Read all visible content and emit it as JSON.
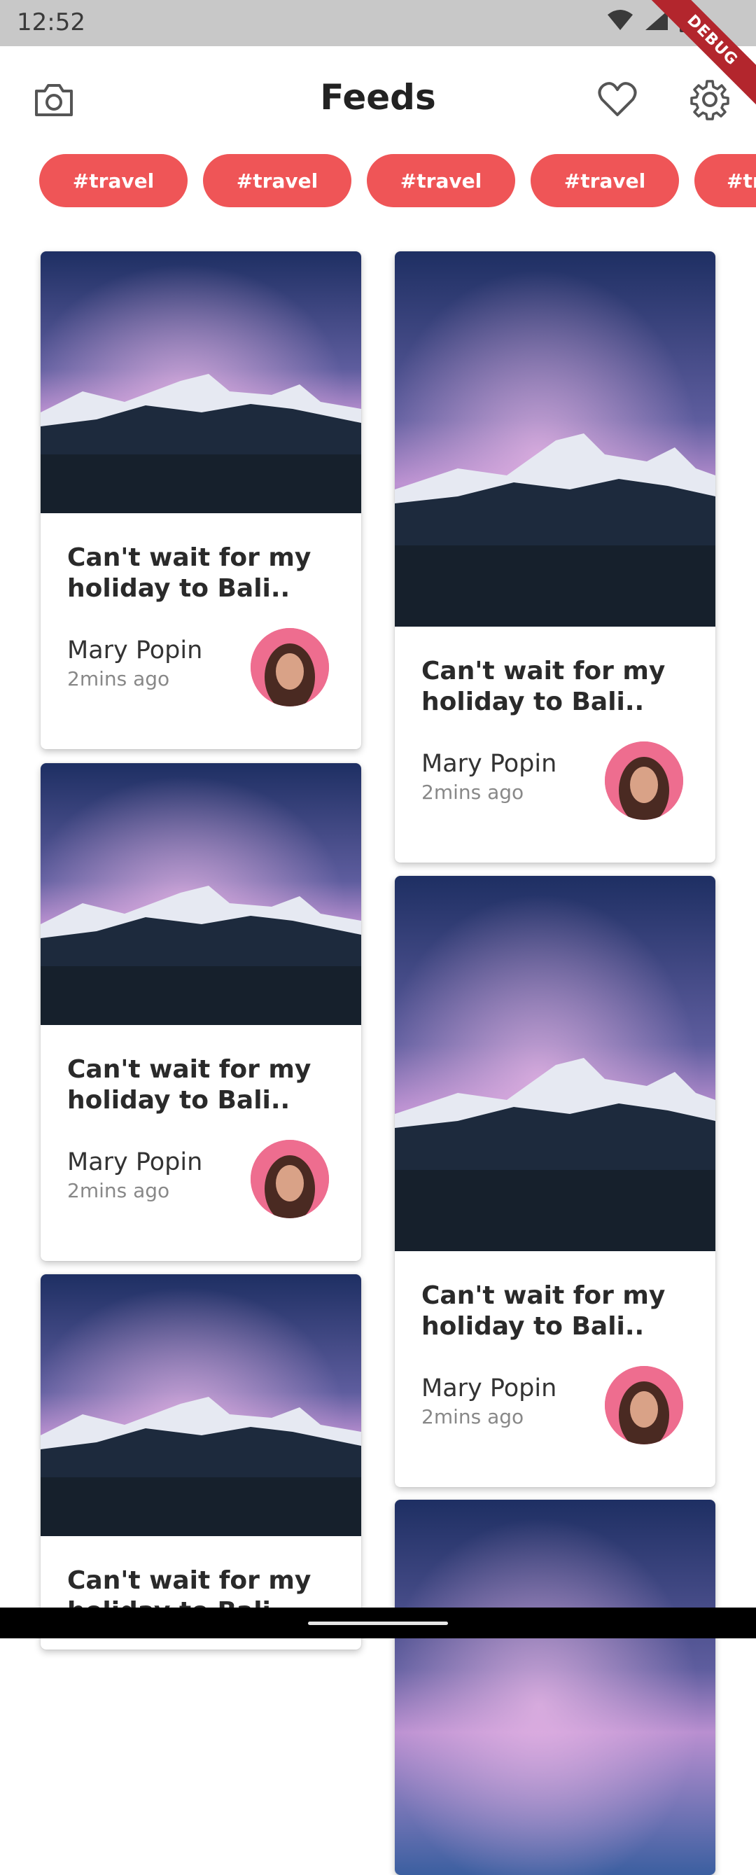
{
  "status_bar": {
    "time": "12:52"
  },
  "debug_banner": "DEBUG",
  "app_bar": {
    "title": "Feeds"
  },
  "tags": [
    "#travel",
    "#travel",
    "#travel",
    "#travel",
    "#tr"
  ],
  "post": {
    "text": "Can't wait for my holiday to Bali..",
    "author": "Mary Popin",
    "time": "2mins ago"
  },
  "colors": {
    "accent": "#ef5557",
    "avatar_bg": "#ee6d8f"
  }
}
